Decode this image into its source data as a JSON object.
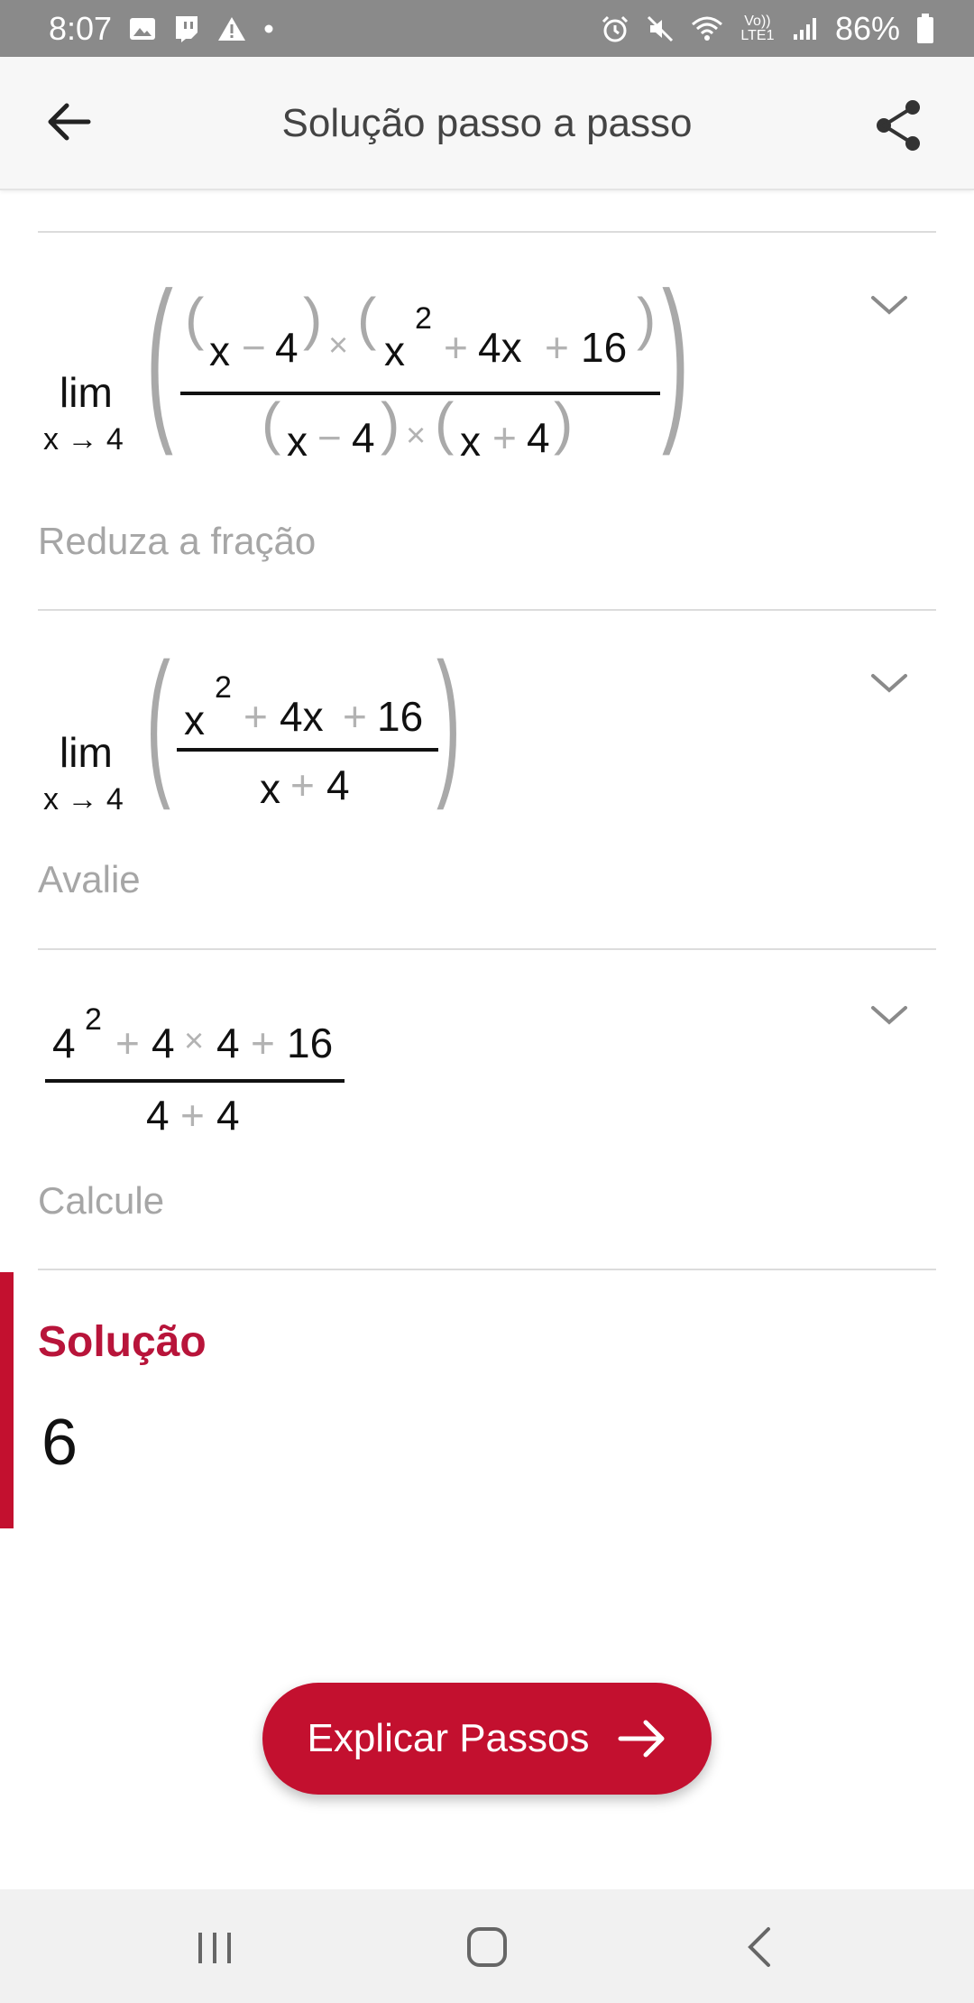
{
  "status_bar": {
    "time": "8:07",
    "battery": "86%",
    "left_icons": [
      "image-icon",
      "twitch-icon",
      "warning-icon",
      "dot-icon"
    ],
    "right_icons": [
      "alarm-icon",
      "mute-icon",
      "wifi-icon",
      "volte-icon",
      "signal-icon",
      "battery-icon"
    ],
    "volte_label": "Vo)) LTE1"
  },
  "app_bar": {
    "title": "Solução passo a passo",
    "back_icon": "arrow-left-icon",
    "share_icon": "share-icon"
  },
  "steps": [
    {
      "lim_label": "lim",
      "lim_sub": "x → 4",
      "numerator": {
        "f1": "x",
        "f1_op": "−",
        "f1_b": "4",
        "times": "×",
        "f2_base": "x",
        "f2_exp": "2",
        "f2_op1": "+",
        "f2_b": "4x",
        "f2_op2": "+",
        "f2_c": "16"
      },
      "denominator": {
        "f1": "x",
        "f1_op": "−",
        "f1_b": "4",
        "times": "×",
        "f2": "x",
        "f2_op": "+",
        "f2_b": "4"
      },
      "caption": "Reduza a fração"
    },
    {
      "lim_label": "lim",
      "lim_sub": "x → 4",
      "numerator": {
        "base": "x",
        "exp": "2",
        "op1": "+",
        "b": "4x",
        "op2": "+",
        "c": "16"
      },
      "denominator": {
        "a": "x",
        "op": "+",
        "b": "4"
      },
      "caption": "Avalie"
    },
    {
      "numerator": {
        "base": "4",
        "exp": "2",
        "op1": "+",
        "b": "4",
        "times": "×",
        "c": "4",
        "op2": "+",
        "d": "16"
      },
      "denominator": {
        "a": "4",
        "op": "+",
        "b": "4"
      },
      "caption": "Calcule"
    }
  ],
  "solution": {
    "label": "Solução",
    "value": "6"
  },
  "cta": {
    "label": "Explicar Passos",
    "icon": "arrow-right-icon"
  },
  "nav_bar": {
    "items": [
      "recents-icon",
      "home-icon",
      "back-icon"
    ]
  },
  "colors": {
    "accent": "#c3102f",
    "status_bar": "#8a8a8a",
    "caption": "#a6a6a6",
    "operator": "#b3b3b3"
  }
}
